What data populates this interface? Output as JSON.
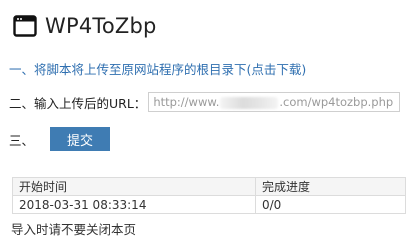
{
  "app": {
    "title": "WP4ToZbp"
  },
  "step1": {
    "number": "一、",
    "text": "将脚本将上传至原网站程序的根目录下",
    "link": "(点击下载)"
  },
  "step2": {
    "label": "二、输入上传后的URL：",
    "placeholder_prefix": "http://www.",
    "placeholder_suffix": ".com/wp4tozbp.php"
  },
  "step3": {
    "number": "三、",
    "button_label": "提交"
  },
  "progress": {
    "headers": [
      "开始时间",
      "完成进度"
    ],
    "rows": [
      [
        "2018-03-31 08:33:14",
        "0/0"
      ]
    ]
  },
  "note": "导入时请不要关闭本页",
  "colors": {
    "accent": "#3f7cb3",
    "link": "#2f6fb0"
  },
  "icons": {
    "app": "browser-window-icon"
  }
}
